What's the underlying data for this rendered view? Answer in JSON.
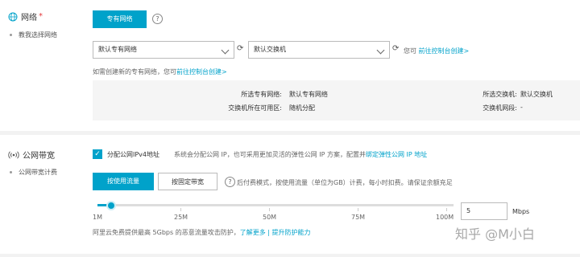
{
  "network_section": {
    "title": "网络",
    "required_mark": "*",
    "subtitle": "教我选择网络",
    "tab_label": "专有网络",
    "help_glyph": "?",
    "vpc_select": "默认专有网络",
    "vswitch_select": "默认交换机",
    "vswitch_hint_prefix": "您可",
    "vswitch_hint_link": "前往控制台创建>",
    "create_hint_prefix": "如需创建新的专有网络，您可",
    "create_hint_link": "前往控制台创建>",
    "summary": {
      "vpc_label": "所选专有网络:",
      "vpc_value": "默认专有网络",
      "zone_label": "交换机所在可用区:",
      "zone_value": "随机分配",
      "vswitch_label": "所选交换机:",
      "vswitch_value": "默认交换机",
      "cidr_label": "交换机网段:",
      "cidr_value": "-"
    }
  },
  "bandwidth_section": {
    "title": "公网带宽",
    "subtitle": "公网带宽计费",
    "checkbox_label": "分配公网IPv4地址",
    "checkbox_checked": true,
    "checkbox_desc": "系统会分配公网 IP，也可采用更加灵活的弹性公网 IP 方案，配置并",
    "checkbox_link": "绑定弹性公网 IP 地址",
    "btn_traffic": "按使用流量",
    "btn_fixed": "按固定带宽",
    "billing_desc": "后付费模式，按使用流量（单位为GB）计费，每小时扣费。请保证余额充足",
    "slider_labels": [
      "1M",
      "25M",
      "50M",
      "75M",
      "100M"
    ],
    "slider_value": 5,
    "slider_max": 100,
    "bandwidth_value": "5",
    "bandwidth_unit": "Mbps",
    "ddos_text": "阿里云免费提供最高 5Gbps 的恶意流量攻击防护，",
    "ddos_link1": "了解更多",
    "ddos_sep": "|",
    "ddos_link2": "提升防护能力"
  },
  "watermark": "知乎 @M小白",
  "colors": {
    "accent": "#00a2ca",
    "required": "#e4393c"
  }
}
